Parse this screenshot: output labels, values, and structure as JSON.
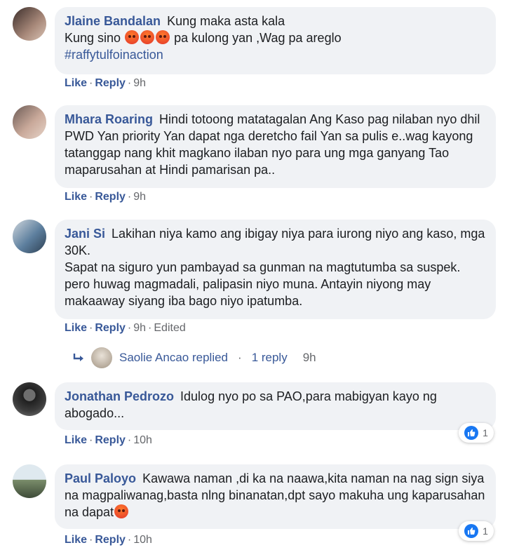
{
  "comments": [
    {
      "author": "Jlaine Bandalan",
      "text1": "Kung maka asta kala",
      "text2a": "Kung sino",
      "text2b": "pa kulong yan ,Wag pa areglo",
      "hashtag": "#raffytulfoinaction",
      "like": "Like",
      "reply": "Reply",
      "time": "9h"
    },
    {
      "author": "Mhara Roaring",
      "text": "Hindi totoong matatagalan Ang Kaso pag nilaban nyo dhil PWD Yan priority Yan dapat nga deretcho fail Yan sa pulis e..wag kayong tatanggap nang khit magkano ilaban nyo para ung mga ganyang Tao maparusahan at Hindi pamarisan pa..",
      "like": "Like",
      "reply": "Reply",
      "time": "9h"
    },
    {
      "author": "Jani Si",
      "text1": "Lakihan niya kamo ang ibigay niya para iurong niyo ang kaso, mga 30K.",
      "text2": "Sapat na siguro yun pambayad sa gunman na magtutumba sa suspek. pero huwag magmadali, palipasin niyo muna. Antayin niyong may makaaway siyang iba bago niyo ipatumba.",
      "like": "Like",
      "reply": "Reply",
      "time": "9h",
      "edited": "Edited"
    },
    {
      "author": "Jonathan Pedrozo",
      "text": "Idulog nyo po sa PAO,para mabigyan kayo ng abogado...",
      "like": "Like",
      "reply": "Reply",
      "time": "10h",
      "reactions": "1"
    },
    {
      "author": "Paul Paloyo",
      "text": "Kawawa naman ,di ka na naawa,kita naman na nag sign siya na magpaliwanag,basta nlng binanatan,dpt sayo makuha ung kaparusahan na dapat",
      "like": "Like",
      "reply": "Reply",
      "time": "10h",
      "reactions": "1"
    }
  ],
  "reply_thread": {
    "name": "Saolie Ancao replied",
    "sep": "·",
    "count": "1 reply",
    "time": "9h"
  },
  "dot": "·",
  "colors": {
    "link": "#385898",
    "bubble": "#f0f2f5",
    "like_blue": "#1877f2"
  }
}
